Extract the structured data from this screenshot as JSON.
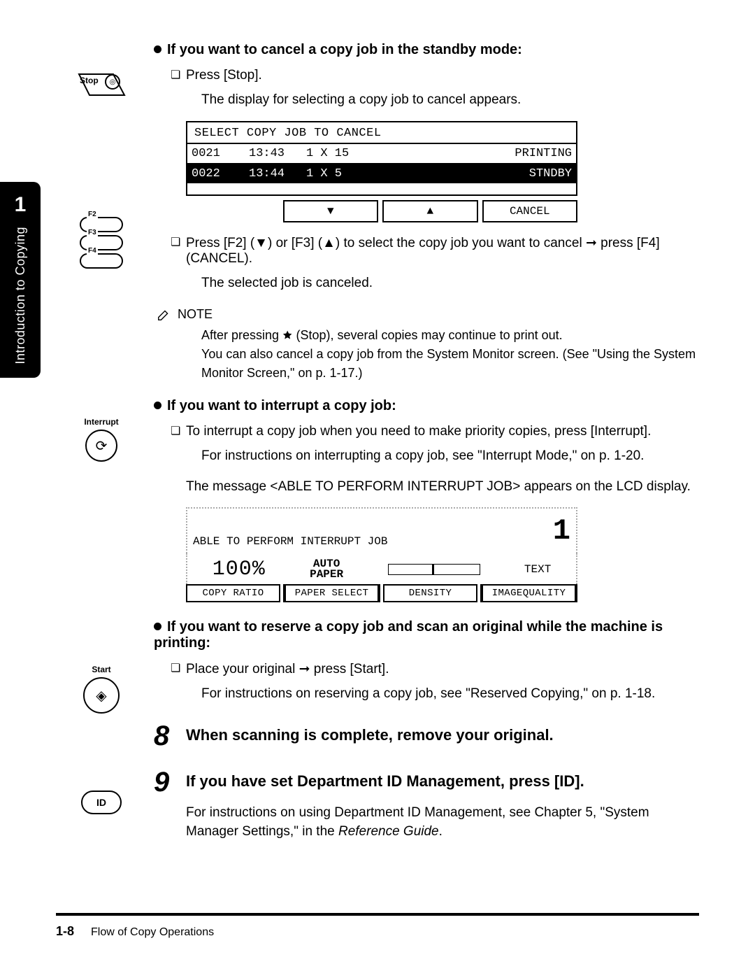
{
  "side_tab": {
    "number": "1",
    "label": "Introduction to Copying"
  },
  "section1": {
    "heading": "If you want to cancel a copy job in the standby mode:",
    "item1": "Press [Stop].",
    "sub1": "The display for selecting a copy job to cancel appears.",
    "lcd": {
      "title": "SELECT COPY JOB TO CANCEL",
      "rows": [
        {
          "id": "0021",
          "time": "13:43",
          "qty": "1 X 15",
          "status": "PRINTING"
        },
        {
          "id": "0022",
          "time": "13:44",
          "qty": "1 X  5",
          "status": "STNDBY"
        }
      ],
      "btns": {
        "down": "▼",
        "up": "▲",
        "cancel": "CANCEL"
      }
    },
    "item2": "Press [F2] (▼) or [F3] (▲) to select the copy job you want to cancel ➞ press [F4] (CANCEL).",
    "sub2": "The selected job is canceled.",
    "note_label": "NOTE",
    "note_body": "After pressing 🟊 (Stop), several copies may continue to print out.\nYou can also cancel a copy job from the System Monitor screen. (See \"Using the System Monitor Screen,\" on p. 1-17.)"
  },
  "section2": {
    "heading": "If you want to interrupt a copy job:",
    "item1": "To interrupt a copy job when you need to make priority copies, press [Interrupt].",
    "sub1": "For instructions on interrupting a copy job, see \"Interrupt Mode,\" on p. 1-20.",
    "sub2": "The message <ABLE TO PERFORM INTERRUPT JOB> appears on the LCD display.",
    "lcd": {
      "title": "ABLE TO PERFORM INTERRUPT JOB",
      "big": "1",
      "pct": "100%",
      "auto_top": "AUTO",
      "auto_bottom": "PAPER",
      "txt": "TEXT",
      "cells": [
        "COPY RATIO",
        "PAPER SELECT",
        "DENSITY",
        "IMAGEQUALITY"
      ]
    }
  },
  "section3": {
    "heading": "If you want to reserve a copy job and scan an original while the machine is printing:",
    "item1": "Place your original ➞ press [Start].",
    "sub1": "For instructions on reserving a copy job, see \"Reserved Copying,\" on p. 1-18."
  },
  "step8": {
    "num": "8",
    "text": "When scanning is complete, remove your original."
  },
  "step9": {
    "num": "9",
    "text": "If you have set Department ID Management, press [ID].",
    "body_1": "For instructions on using Department ID Management, see Chapter 5, \"System Manager Settings,\" in the ",
    "body_2": "Reference Guide",
    "body_3": "."
  },
  "footer": {
    "page": "1-8",
    "title": "Flow of Copy Operations"
  },
  "icons": {
    "stop_label": "Stop",
    "f2": "F2",
    "f3": "F3",
    "f4": "F4",
    "interrupt_label": "Interrupt",
    "start_label": "Start",
    "id_label": "ID"
  }
}
